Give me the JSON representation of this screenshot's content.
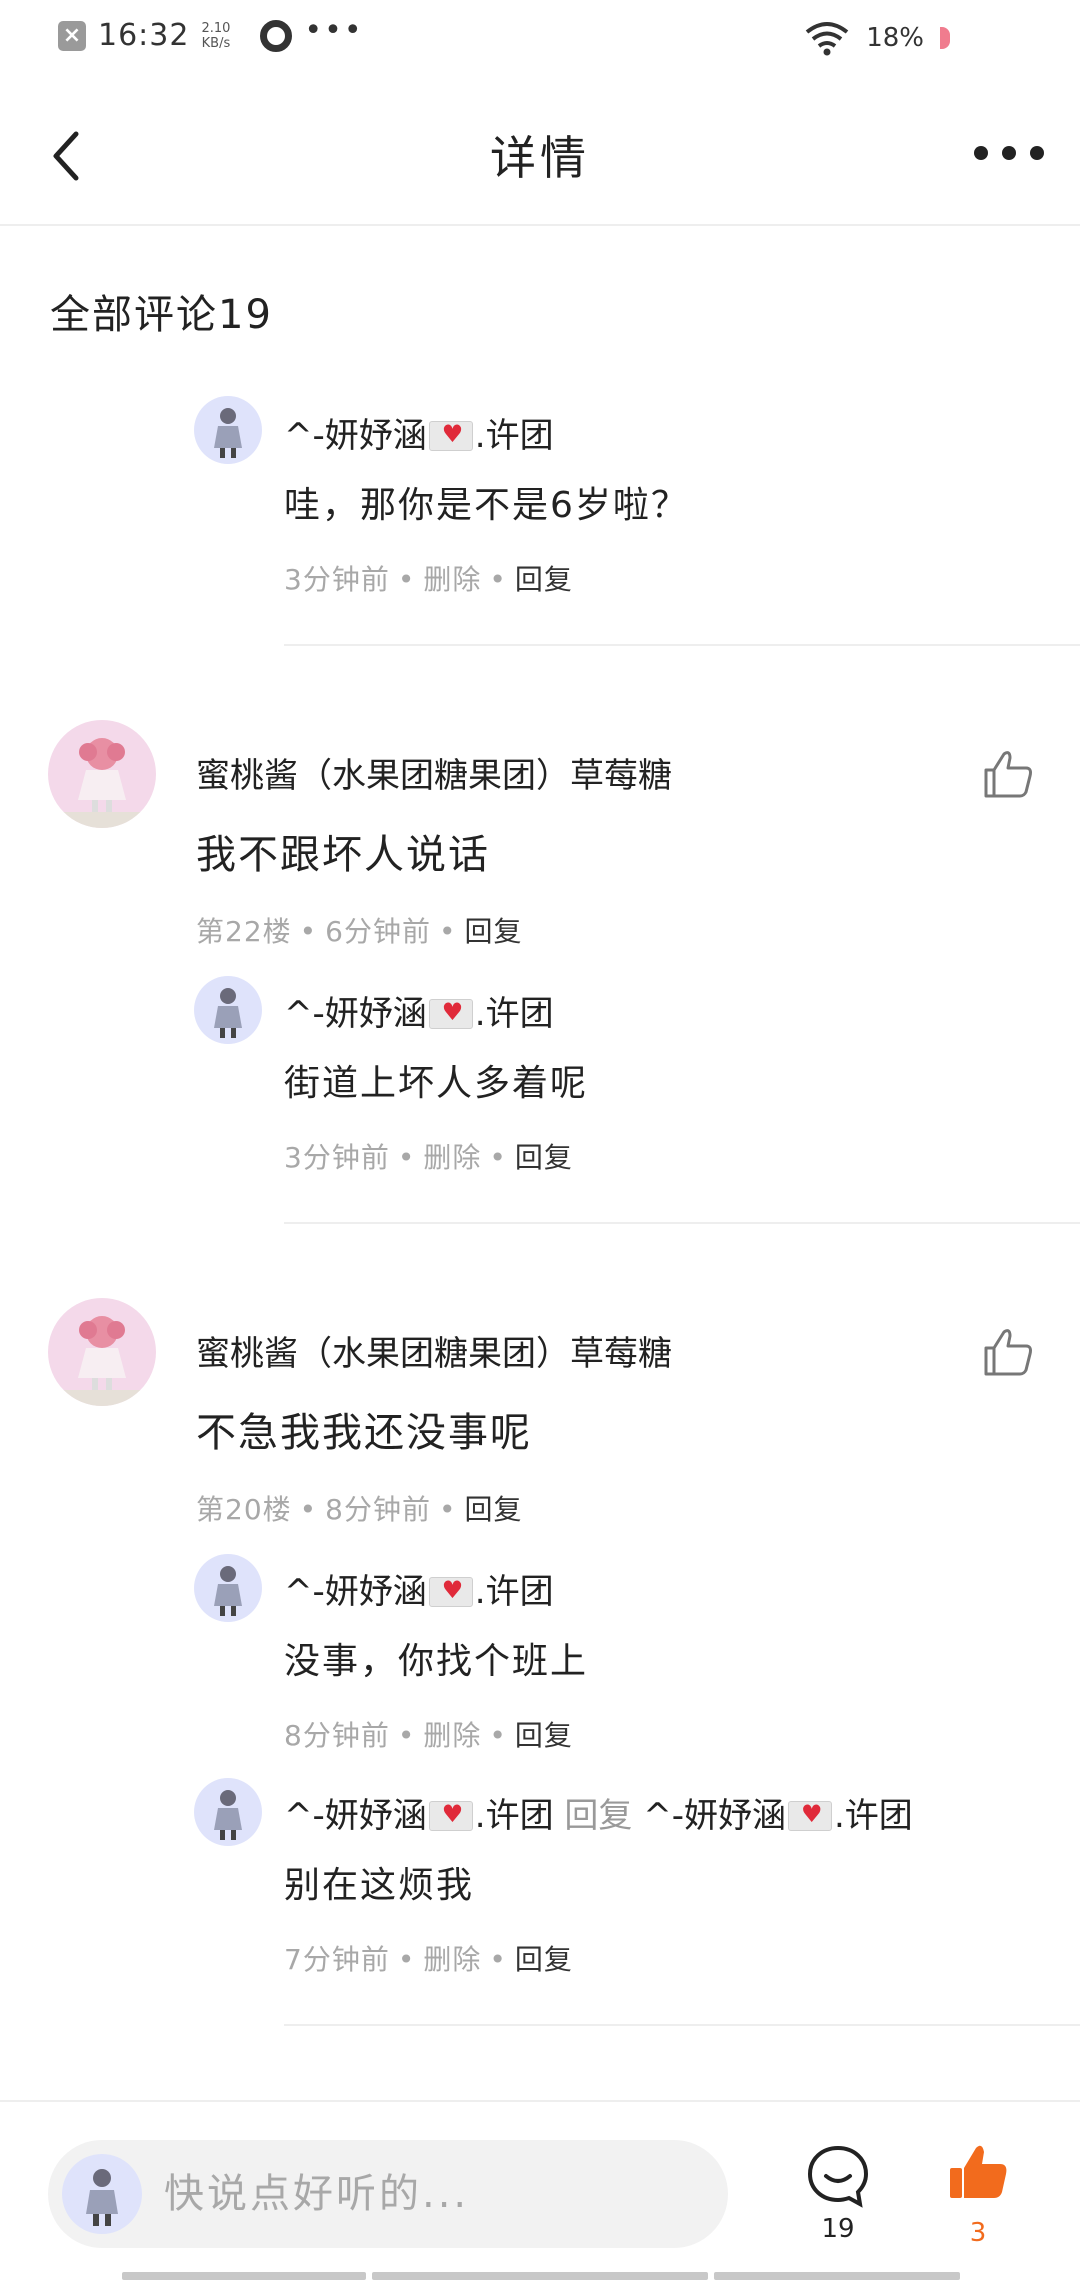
{
  "status_bar": {
    "time": "16:32",
    "speed_value": "2.10",
    "speed_unit": "KB/s",
    "battery": "18%",
    "dots": "•••"
  },
  "nav": {
    "title": "详情"
  },
  "section": {
    "title": "全部评论19"
  },
  "reply_word": "回复",
  "comments": [
    {
      "replies": [
        {
          "name_prefix": "^-妍妤涵",
          "name_suffix": ".许团",
          "text": "哇，那你是不是6岁啦？",
          "time": "3分钟前",
          "delete": "删除",
          "reply": "回复"
        }
      ]
    },
    {
      "name": "蜜桃酱（水果团糖果团）草莓糖",
      "text": "我不跟坏人说话",
      "floor": "第22楼",
      "time": "6分钟前",
      "reply": "回复",
      "replies": [
        {
          "name_prefix": "^-妍妤涵",
          "name_suffix": ".许团",
          "text": "街道上坏人多着呢",
          "time": "3分钟前",
          "delete": "删除",
          "reply": "回复"
        }
      ]
    },
    {
      "name": "蜜桃酱（水果团糖果团）草莓糖",
      "text": "不急我我还没事呢",
      "floor": "第20楼",
      "time": "8分钟前",
      "reply": "回复",
      "replies": [
        {
          "name_prefix": "^-妍妤涵",
          "name_suffix": ".许团",
          "text": "没事，你找个班上",
          "time": "8分钟前",
          "delete": "删除",
          "reply": "回复"
        },
        {
          "name_prefix": "^-妍妤涵",
          "name_suffix": ".许团",
          "reply_to_prefix": "^-妍妤涵",
          "reply_to_suffix": ".许团",
          "text": "别在这烦我",
          "time": "7分钟前",
          "delete": "删除",
          "reply": "回复"
        }
      ]
    }
  ],
  "bottom_bar": {
    "placeholder": "快说点好听的...",
    "comment_count": "19",
    "like_count": "3",
    "like_color": "#f26b1d"
  }
}
